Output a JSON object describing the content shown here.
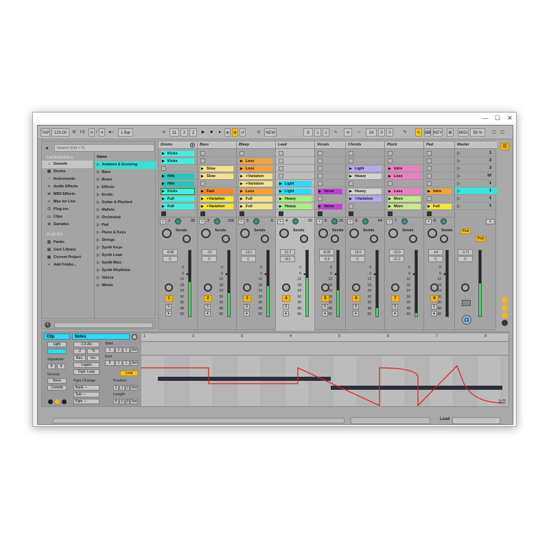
{
  "window": {
    "minimize": "—",
    "maximize": "☐",
    "close": "✕"
  },
  "control_bar": {
    "tap": "TAP",
    "tempo": "120.00",
    "tempo_ticks": "III",
    "tempo_dots": "I II",
    "sig_num": "4",
    "sig_den": "4",
    "metro": "●○",
    "quant": "1 Bar",
    "pos_bar": "11",
    "pos_beat": "2",
    "pos_sixteenth": "2",
    "new": "NEW",
    "loop_start": [
      "9",
      "1",
      "1"
    ],
    "loop_len": [
      "24",
      "0",
      "0"
    ],
    "key": "KEY",
    "midi": "MIDI",
    "cpu": "39 %"
  },
  "browser": {
    "search_placeholder": "Search (Ctrl + F)",
    "categories_header": "CATEGORIES",
    "categories": [
      {
        "icon": "♪",
        "label": "Sounds"
      },
      {
        "icon": "▦",
        "label": "Drums"
      },
      {
        "icon": "◔",
        "label": "Instruments"
      },
      {
        "icon": "∿",
        "label": "Audio Effects"
      },
      {
        "icon": "⇌",
        "label": "MIDI Effects"
      },
      {
        "icon": "∞",
        "label": "Max for Live"
      },
      {
        "icon": "⏻",
        "label": "Plug-ins"
      },
      {
        "icon": "▭",
        "label": "Clips"
      },
      {
        "icon": "≋",
        "label": "Samples"
      }
    ],
    "places_header": "PLACES",
    "places": [
      {
        "icon": "▥",
        "label": "Packs"
      },
      {
        "icon": "▤",
        "label": "User Library"
      },
      {
        "icon": "▦",
        "label": "Current Project"
      },
      {
        "icon": "+",
        "label": "Add Folder..."
      }
    ],
    "name_header": "Name",
    "items": [
      "Ambient & Evolving",
      "Bass",
      "Brass",
      "Effects",
      "Exotic",
      "Guitar & Plucked",
      "Mallets",
      "Orchestral",
      "Pad",
      "Piano & Keys",
      "Strings",
      "Synth Keys",
      "Synth Lead",
      "Synth Misc",
      "Synth Rhythmic",
      "Voices",
      "Winds"
    ]
  },
  "session": {
    "tracks": [
      {
        "name": "Drums",
        "num": "1",
        "sendval": "32",
        "vol": "-8.86",
        "pan": "C",
        "meter": 0.52,
        "clips": [
          {
            "label": "Kicks",
            "color": "#3ff0e0"
          },
          {
            "label": "Kicks",
            "color": "#3ff0e0"
          },
          null,
          {
            "label": "Hihi",
            "color": "#22c7bd"
          },
          {
            "label": "Hihi",
            "color": "#22c7bd"
          },
          {
            "label": "Kicks",
            "color": "#3ff0e0",
            "playing": true
          },
          {
            "label": "Full",
            "color": "#3ff0e0"
          },
          {
            "label": "Full",
            "color": "#3ff0e0"
          }
        ]
      },
      {
        "name": "Bass",
        "num": "2",
        "sendval": "126",
        "vol": "-12",
        "pan": "C",
        "meter": 0.35,
        "clips": [
          null,
          null,
          {
            "label": "Slow",
            "color": "#f6e28d"
          },
          {
            "label": "Slow",
            "color": "#f6e28d"
          },
          null,
          {
            "label": "Fast",
            "color": "#f58a1e"
          },
          {
            "label": "+Variation",
            "color": "#f6e43a"
          },
          {
            "label": "+Variation",
            "color": "#f6e43a"
          }
        ]
      },
      {
        "name": "Bleep",
        "num": "3",
        "sendval": "6",
        "vol": "-13.2",
        "pan": "C",
        "meter": 0.46,
        "clips": [
          null,
          {
            "label": "Less",
            "color": "#f7a135"
          },
          {
            "label": "Less",
            "color": "#f7a135"
          },
          {
            "label": "+Variation",
            "color": "#f6e28d"
          },
          {
            "label": "+Variation",
            "color": "#f6e28d"
          },
          {
            "label": "Less",
            "color": "#f7a135"
          },
          {
            "label": "Full",
            "color": "#f6e28d"
          },
          {
            "label": "Full",
            "color": "#f6e28d"
          }
        ]
      },
      {
        "name": "Lead",
        "num": "4",
        "sendval": "32",
        "vol": "-11.7",
        "pan": "-8.1",
        "meter": 0.58,
        "selected": true,
        "clips": [
          null,
          null,
          null,
          null,
          {
            "label": "Light",
            "color": "#2fd9f7"
          },
          {
            "label": "Light",
            "color": "#2fd9f7"
          },
          {
            "label": "Heavy",
            "color": "#a6f27c"
          },
          {
            "label": "Heavy",
            "color": "#a6f27c"
          }
        ]
      },
      {
        "name": "Vocals",
        "num": "5",
        "sendval": "16",
        "vol": "-8.05",
        "pan": "-9.3",
        "meter": 0.4,
        "clips": [
          null,
          null,
          null,
          null,
          null,
          {
            "label": "Verse",
            "color": "#c03fd6"
          },
          null,
          {
            "label": "Verse",
            "color": "#c03fd6"
          }
        ]
      },
      {
        "name": "Chords",
        "num": "6",
        "sendval": "64",
        "vol": "-19.0",
        "pan": "C",
        "meter": 0.12,
        "clips": [
          null,
          null,
          {
            "label": "Light",
            "color": "#b9a8f2"
          },
          {
            "label": "Heavy",
            "color": "#d2d2d2"
          },
          null,
          {
            "label": "Heavy",
            "color": "#d2d2d2"
          },
          {
            "label": "+Variation",
            "color": "#b9a8f2"
          },
          null
        ]
      },
      {
        "name": "Pluck",
        "num": "7",
        "sendval": "",
        "vol": "-10.0",
        "pan": "-11.2",
        "meter": 0.05,
        "clips": [
          null,
          null,
          {
            "label": "Intro",
            "color": "#f07cc2"
          },
          {
            "label": "Less",
            "color": "#f07cc2"
          },
          null,
          {
            "label": "Less",
            "color": "#f07cc2"
          },
          {
            "label": "More",
            "color": "#c9e88a"
          },
          {
            "label": "More",
            "color": "#c9e88a"
          }
        ]
      },
      {
        "name": "Pad",
        "num": "8",
        "sendval": "",
        "vol": "-inf",
        "pan": "C",
        "meter": 0.0,
        "clips": [
          null,
          null,
          null,
          null,
          null,
          {
            "label": "Intro",
            "color": "#f7a135"
          },
          null,
          {
            "label": "Full",
            "color": "#f6e43a"
          }
        ]
      }
    ],
    "master": {
      "name": "Master",
      "scenes": [
        "1",
        "2",
        "3",
        "10",
        "1",
        "1",
        "1",
        "1"
      ],
      "vol": "-3.71",
      "pan": "C",
      "meter": 0.5,
      "post": "Post",
      "post2": "Post"
    },
    "sends_label": "Sends",
    "db_scale": [
      "0",
      "6",
      "12",
      "18",
      "24",
      "30",
      "36",
      "48",
      "60"
    ],
    "stop_label": "■",
    "solo_label": "S"
  },
  "clip_view": {
    "clip_tab": "Clip",
    "notes_tab": "Notes",
    "clip_color_label": "Light",
    "signature_label": "Signature",
    "sig_num": "4",
    "sig_den": "4",
    "groove_label": "Groove",
    "groove_val": "None",
    "commit": "Commit",
    "start_label": "Start",
    "end_label": "End",
    "position_label": "Position",
    "length_label": "Length",
    "start": [
      "1",
      "1",
      "1"
    ],
    "end": [
      "9",
      "1",
      "1"
    ],
    "position": [
      "1",
      "1",
      "1"
    ],
    "length": [
      "8",
      "0",
      "0"
    ],
    "set": "Set",
    "loop": "Loop",
    "pgm_change": "Pgm Change",
    "bank": "Bank ---",
    "sub": "Sub ---",
    "pgm": "Pgm ---",
    "btn_half": ":2",
    "btn_double": "*2",
    "btn_reverse": "Rev.",
    "btn_invert": "Inv.",
    "btn_legato": "Legato",
    "btn_dupe": "Dupl. Loop",
    "ruler": [
      "1",
      "2",
      "3",
      "4",
      "5",
      "6",
      "7",
      "8"
    ],
    "range": "1/2"
  },
  "status": {
    "bottom_right": "Lead"
  },
  "colors": {
    "accent": "#f7c21e",
    "meter": "#4fd16a",
    "envelope": "#e02020"
  }
}
